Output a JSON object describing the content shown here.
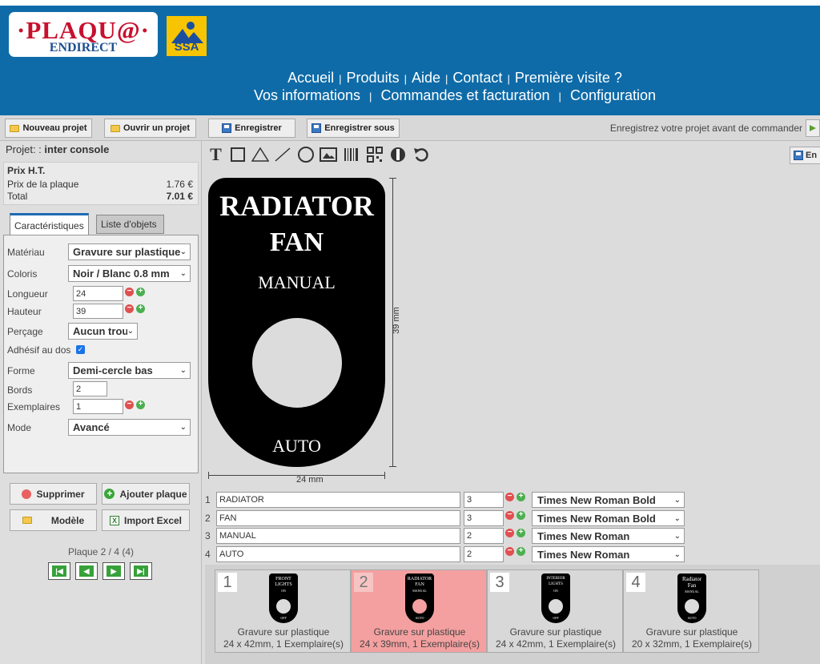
{
  "brand": {
    "logo_main": "·PLAQU@·",
    "logo_sub": "ENDIRECT",
    "partner": "SSA"
  },
  "nav": {
    "row1": [
      "Accueil",
      "Produits",
      "Aide",
      "Contact",
      "Première visite ?"
    ],
    "row2": [
      "Vos informations",
      "Commandes et facturation",
      "Configuration"
    ]
  },
  "toolbar": {
    "new_project": "Nouveau projet",
    "open_project": "Ouvrir un projet",
    "save": "Enregistrer",
    "save_as": "Enregistrer sous",
    "hint": "Enregistrez votre projet avant de commander",
    "save_right": "En"
  },
  "project": {
    "label": "Projet: :",
    "name": "inter console"
  },
  "price": {
    "header": "Prix H.T.",
    "plate_label": "Prix de la plaque",
    "plate_value": "1.76 €",
    "total_label": "Total",
    "total_value": "7.01 €"
  },
  "tabs": {
    "characteristics": "Caractéristiques",
    "objects": "Liste d'objets"
  },
  "props": {
    "material_label": "Matériau",
    "material": "Gravure sur plastique",
    "color_label": "Coloris",
    "color": "Noir / Blanc 0.8 mm",
    "length_label": "Longueur",
    "length": "24",
    "height_label": "Hauteur",
    "height": "39",
    "drilling_label": "Perçage",
    "drilling": "Aucun trou",
    "adhesive_label": "Adhésif au dos",
    "shape_label": "Forme",
    "shape": "Demi-cercle bas",
    "edges_label": "Bords",
    "edges": "2",
    "copies_label": "Exemplaires",
    "copies": "1",
    "mode_label": "Mode",
    "mode": "Avancé"
  },
  "actions": {
    "delete": "Supprimer",
    "add_plate": "Ajouter plaque",
    "template": "Modèle",
    "import_excel": "Import Excel"
  },
  "pager": {
    "text": "Plaque 2 / 4 (4)"
  },
  "plate": {
    "lines": [
      "RADIATOR",
      "FAN",
      "MANUAL",
      "AUTO"
    ],
    "height_dim": "39 mm",
    "width_dim": "24 mm"
  },
  "text_rows": [
    {
      "num": "1",
      "text": "RADIATOR",
      "size": "3",
      "font": "Times New Roman Bold"
    },
    {
      "num": "2",
      "text": "FAN",
      "size": "3",
      "font": "Times New Roman Bold"
    },
    {
      "num": "3",
      "text": "MANUAL",
      "size": "2",
      "font": "Times New Roman"
    },
    {
      "num": "4",
      "text": "AUTO",
      "size": "2",
      "font": "Times New Roman"
    }
  ],
  "gallery": [
    {
      "num": "1",
      "thumb": [
        "FRONT",
        "LIGHTS",
        "ON",
        "OFF"
      ],
      "line1": "Gravure sur plastique",
      "line2": "24 x 42mm, 1 Exemplaire(s)"
    },
    {
      "num": "2",
      "thumb": [
        "RADIATOR",
        "FAN",
        "MANUAL",
        "AUTO"
      ],
      "line1": "Gravure sur plastique",
      "line2": "24 x 39mm, 1 Exemplaire(s)"
    },
    {
      "num": "3",
      "thumb": [
        "INTERIOR",
        "LIGHTS",
        "ON",
        "OFF"
      ],
      "line1": "Gravure sur plastique",
      "line2": "24 x 42mm, 1 Exemplaire(s)"
    },
    {
      "num": "4",
      "thumb": [
        "Radiator",
        "Fan",
        "MANUAL",
        "AUTO"
      ],
      "line1": "Gravure sur plastique",
      "line2": "20 x 32mm, 1 Exemplaire(s)"
    }
  ]
}
